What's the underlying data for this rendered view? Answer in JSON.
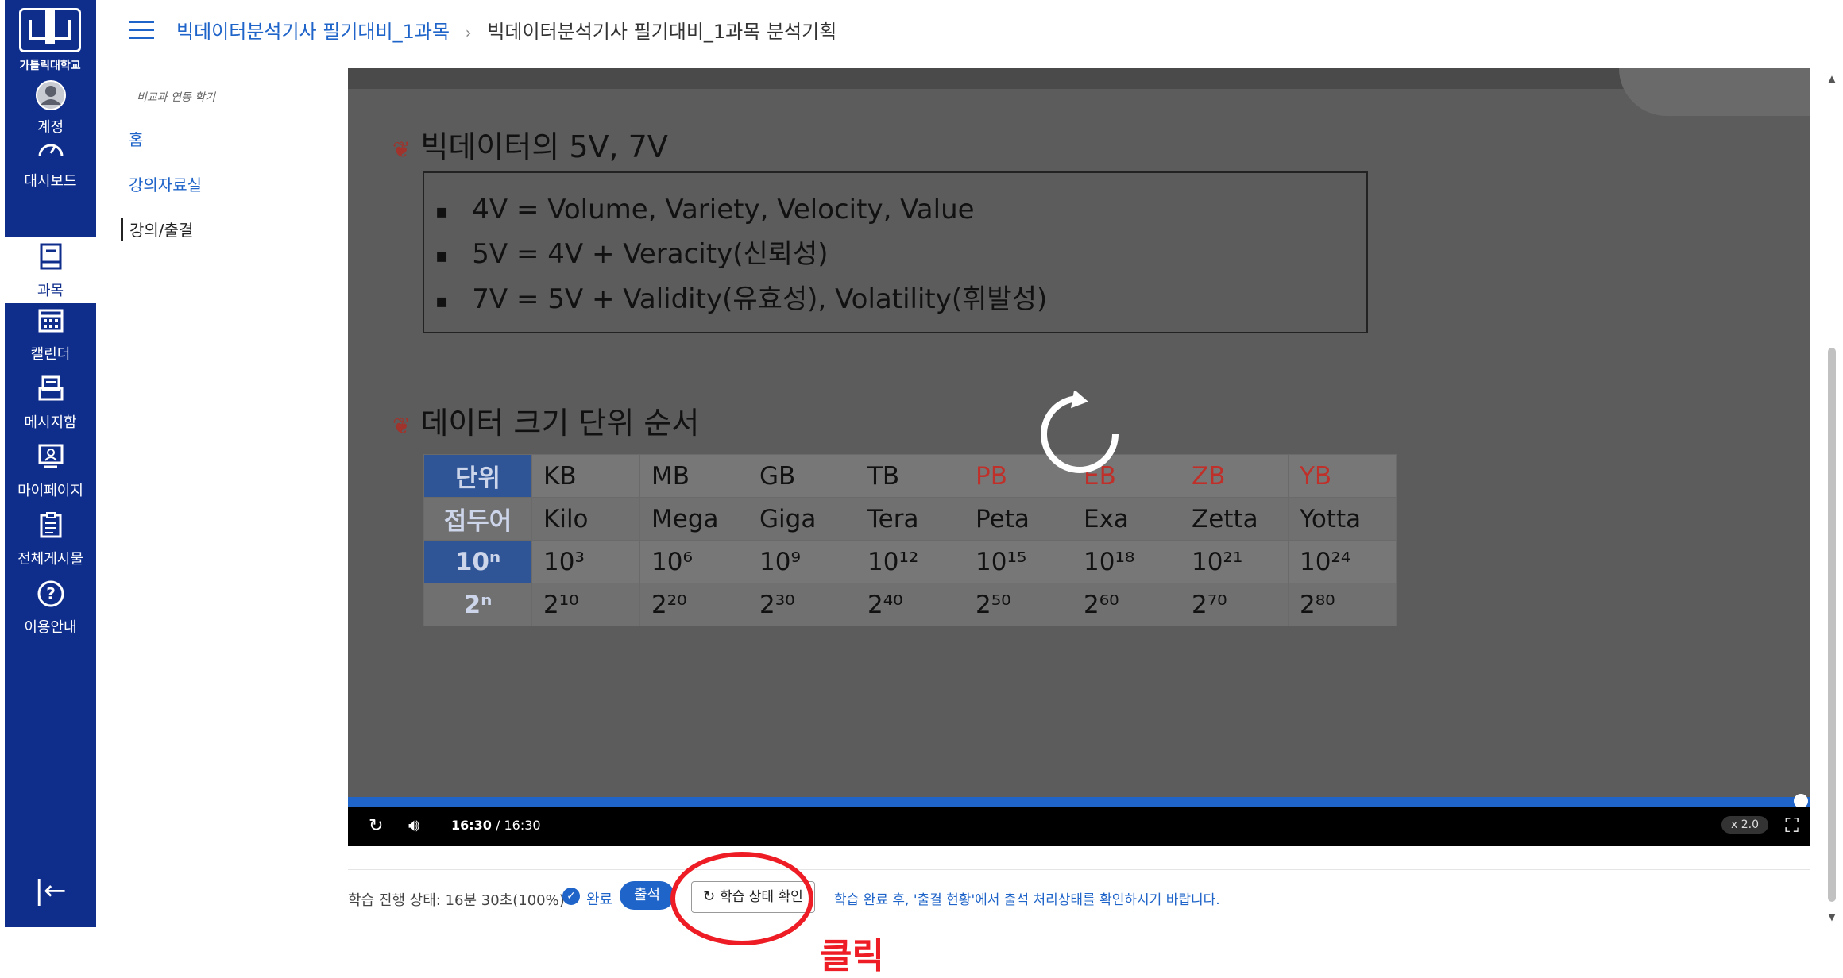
{
  "gnav": {
    "logo_text": "가톨릭대학교",
    "items": [
      {
        "label": "계정",
        "icon": "account-icon"
      },
      {
        "label": "대시보드",
        "icon": "dashboard-icon"
      },
      {
        "label": "과목",
        "icon": "course-icon"
      },
      {
        "label": "캘린더",
        "icon": "calendar-icon"
      },
      {
        "label": "메시지함",
        "icon": "inbox-icon"
      },
      {
        "label": "마이페이지",
        "icon": "mypage-icon"
      },
      {
        "label": "전체게시물",
        "icon": "board-icon"
      },
      {
        "label": "이용안내",
        "icon": "help-icon"
      }
    ],
    "collapse_glyph": "|←"
  },
  "breadcrumb": {
    "course": "빅데이터분석기사 필기대비_1과목",
    "current": "빅데이터분석기사 필기대비_1과목 분석기획"
  },
  "course_nav": {
    "term": "비교과 연동 학기",
    "items": [
      "홈",
      "강의자료실",
      "강의/출결"
    ]
  },
  "slide": {
    "section1": "빅데이터의 5V, 7V",
    "bullets": [
      "4V = Volume, Variety, Velocity, Value",
      "5V = 4V + Veracity(신뢰성)",
      "7V = 5V + Validity(유효성), Volatility(휘발성)"
    ],
    "section2": "데이터 크기 단위 순서",
    "table": {
      "row_headers": [
        "단위",
        "접두어",
        "10ⁿ",
        "2ⁿ"
      ],
      "units": [
        "KB",
        "MB",
        "GB",
        "TB",
        "PB",
        "EB",
        "ZB",
        "YB"
      ],
      "prefixes": [
        "Kilo",
        "Mega",
        "Giga",
        "Tera",
        "Peta",
        "Exa",
        "Zetta",
        "Yotta"
      ],
      "pow10": [
        "10³",
        "10⁶",
        "10⁹",
        "10¹²",
        "10¹⁵",
        "10¹⁸",
        "10²¹",
        "10²⁴"
      ],
      "pow2": [
        "2¹⁰",
        "2²⁰",
        "2³⁰",
        "2⁴⁰",
        "2⁵⁰",
        "2⁶⁰",
        "2⁷⁰",
        "2⁸⁰"
      ]
    }
  },
  "player": {
    "time_current": "16:30",
    "time_sep": " / ",
    "time_total": "16:30",
    "progress": 1.0,
    "speed": "x 2.0"
  },
  "status": {
    "label": "학습 진행 상태: 16분 30초(100%)",
    "done": "완료",
    "attend": "출석",
    "check_button": "학습 상태 확인",
    "note": "학습 완료 후, '출결 현황'에서 출석 처리상태를 확인하시기 바랍니다."
  },
  "annotation": {
    "label": "클릭",
    "color": "#ee1c24"
  },
  "colors": {
    "nav_bg": "#0f2e8c",
    "accent": "#1f64c9"
  }
}
